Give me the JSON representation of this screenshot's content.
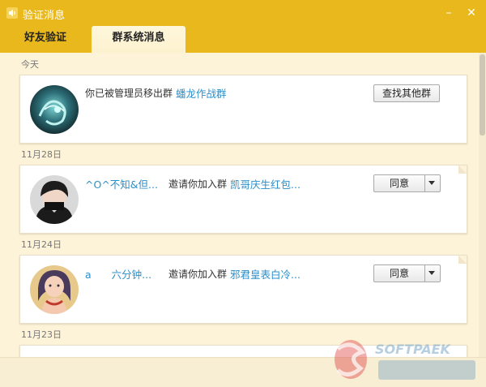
{
  "window": {
    "title": "验证消息",
    "minimize_icon": "minimize-icon",
    "close_icon": "close-icon"
  },
  "tabs": [
    {
      "label": "好友验证",
      "active": false
    },
    {
      "label": "群系统消息",
      "active": true
    }
  ],
  "groups": [
    {
      "date": "今天",
      "message": {
        "text": "你已被管理员移出群",
        "group_name": "蟠龙作战群",
        "button": "查找其他群"
      }
    },
    {
      "date": "11月28日",
      "message": {
        "user": "^O^不知&但...",
        "text": "邀请你加入群",
        "group_name": "凯哥庆生红包...",
        "button": "同意"
      }
    },
    {
      "date": "11月24日",
      "message": {
        "user": "a　　六分钟...",
        "text": "邀请你加入群",
        "group_name": "邪君皇表白冷...",
        "button": "同意"
      }
    },
    {
      "date": "11月23日"
    }
  ],
  "watermark": {
    "text": "SOFTPAEK"
  },
  "colors": {
    "titlebar": "#e8b81c",
    "content_bg": "#fdf3d8",
    "link": "#2b8fc9"
  }
}
